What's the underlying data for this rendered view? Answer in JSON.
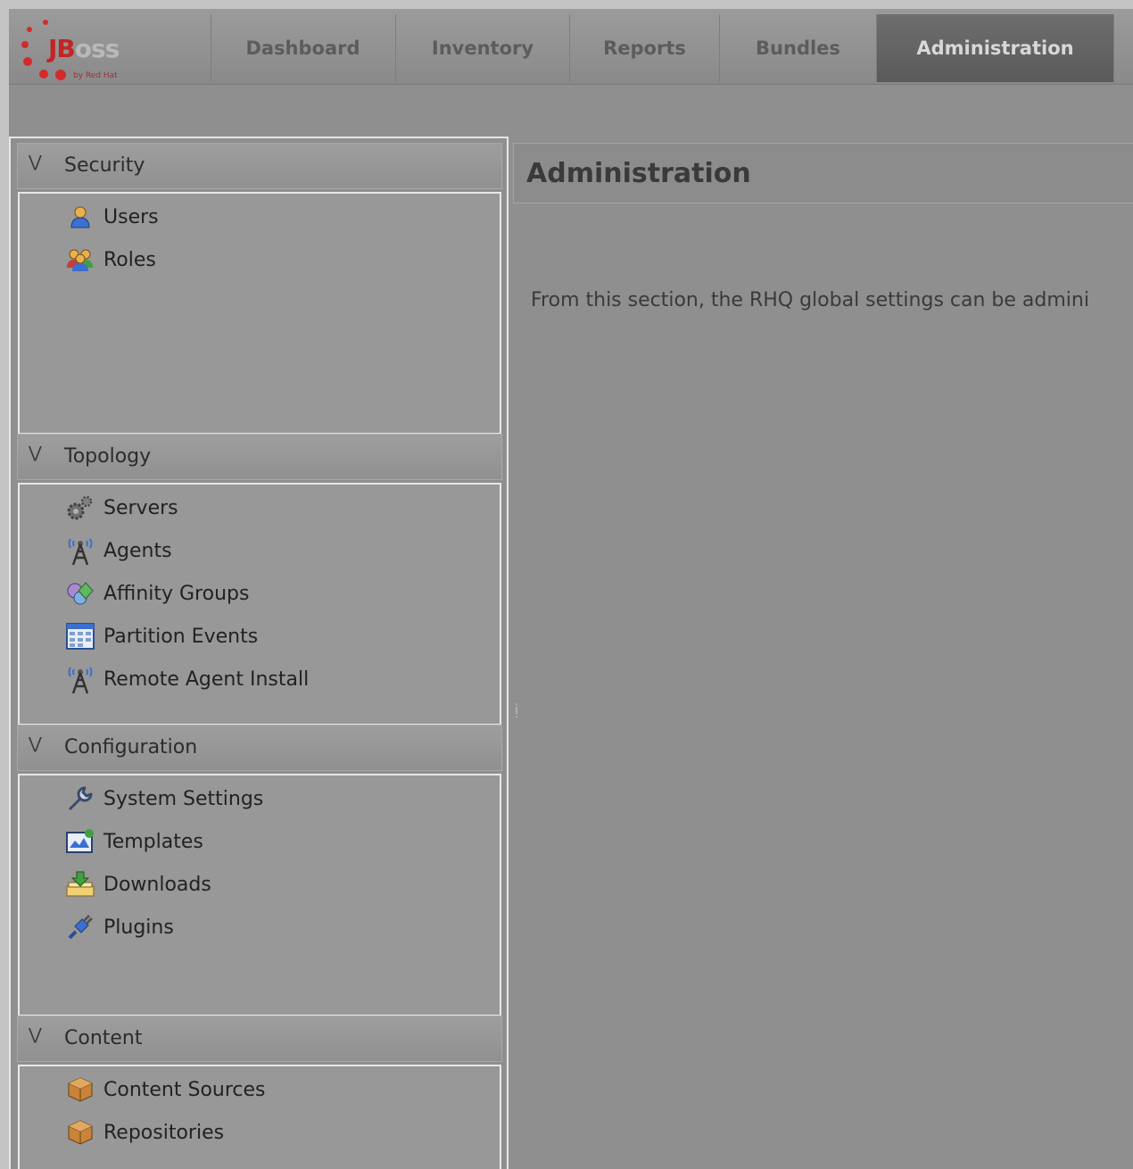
{
  "app": {
    "logo_text": "JBoss",
    "logo_byline": "by Red Hat"
  },
  "nav": {
    "tabs": [
      {
        "label": "Dashboard",
        "active": false
      },
      {
        "label": "Inventory",
        "active": false
      },
      {
        "label": "Reports",
        "active": false
      },
      {
        "label": "Bundles",
        "active": false
      },
      {
        "label": "Administration",
        "active": true
      }
    ]
  },
  "sidebar": {
    "sections": [
      {
        "title": "Security",
        "items": [
          {
            "label": "Users",
            "icon": "user-icon"
          },
          {
            "label": "Roles",
            "icon": "group-icon"
          }
        ]
      },
      {
        "title": "Topology",
        "items": [
          {
            "label": "Servers",
            "icon": "gears-icon"
          },
          {
            "label": "Agents",
            "icon": "antenna-icon"
          },
          {
            "label": "Affinity Groups",
            "icon": "affinity-icon"
          },
          {
            "label": "Partition Events",
            "icon": "calendar-icon"
          },
          {
            "label": "Remote Agent Install",
            "icon": "antenna-icon"
          }
        ]
      },
      {
        "title": "Configuration",
        "items": [
          {
            "label": "System Settings",
            "icon": "wrench-icon"
          },
          {
            "label": "Templates",
            "icon": "template-icon"
          },
          {
            "label": "Downloads",
            "icon": "download-icon"
          },
          {
            "label": "Plugins",
            "icon": "plug-icon"
          }
        ]
      },
      {
        "title": "Content",
        "items": [
          {
            "label": "Content Sources",
            "icon": "package-icon"
          },
          {
            "label": "Repositories",
            "icon": "package-icon"
          }
        ]
      }
    ]
  },
  "main": {
    "title": "Administration",
    "text": "From this section, the RHQ global settings can be admini"
  },
  "colors": {
    "background": "#8f8f8f",
    "active_tab": "#5e5e5e",
    "logo_red": "#c42424"
  }
}
